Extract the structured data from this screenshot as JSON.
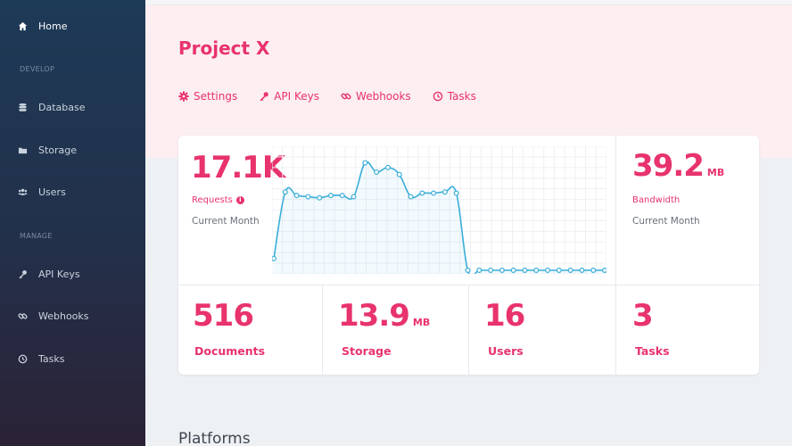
{
  "sidebar": {
    "items": [
      {
        "label": "Home",
        "icon": "home-icon"
      },
      {
        "label": "Database",
        "icon": "database-icon"
      },
      {
        "label": "Storage",
        "icon": "folder-icon"
      },
      {
        "label": "Users",
        "icon": "users-icon"
      },
      {
        "label": "API Keys",
        "icon": "key-icon"
      },
      {
        "label": "Webhooks",
        "icon": "link-icon"
      },
      {
        "label": "Tasks",
        "icon": "clock-icon"
      }
    ],
    "sections": {
      "develop": "DEVELOP",
      "manage": "MANAGE"
    }
  },
  "header": {
    "title": "Project X",
    "tabs": [
      {
        "label": "Settings",
        "icon": "gear-icon"
      },
      {
        "label": "API Keys",
        "icon": "key-icon"
      },
      {
        "label": "Webhooks",
        "icon": "link-icon"
      },
      {
        "label": "Tasks",
        "icon": "clock-icon"
      }
    ]
  },
  "stats": {
    "requests": {
      "value": "17.1K",
      "label": "Requests",
      "sub": "Current Month"
    },
    "bandwidth": {
      "value": "39.2",
      "unit": "MB",
      "label": "Bandwidth",
      "sub": "Current Month"
    },
    "documents": {
      "value": "516",
      "label": "Documents"
    },
    "storage": {
      "value": "13.9",
      "unit": "MB",
      "label": "Storage"
    },
    "users": {
      "value": "16",
      "label": "Users"
    },
    "tasks": {
      "value": "3",
      "label": "Tasks"
    }
  },
  "chart_data": {
    "type": "line",
    "values": [
      10,
      67,
      64,
      63,
      62,
      64,
      64,
      63,
      92,
      84,
      88,
      82,
      63,
      66,
      66,
      67,
      66,
      0,
      0,
      0,
      0,
      0,
      0,
      0,
      0,
      0,
      0,
      0,
      0,
      0
    ],
    "grid": true,
    "color": "#3aaed8"
  },
  "platforms": {
    "title": "Platforms"
  },
  "colors": {
    "accent": "#e8336c",
    "sidebar": "#1d3a57",
    "header_band": "#fdeef1"
  }
}
